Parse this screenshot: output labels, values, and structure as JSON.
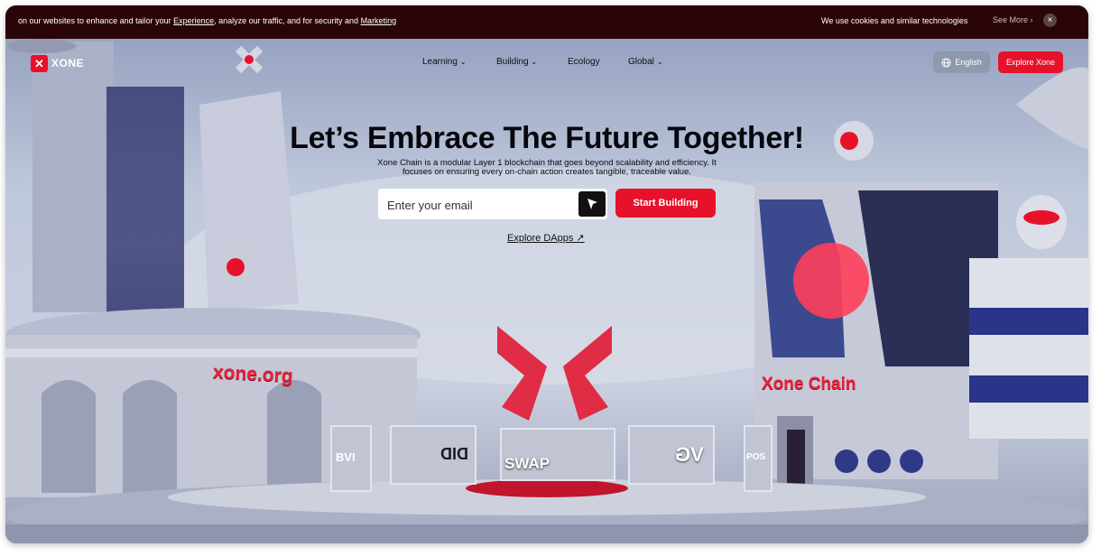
{
  "cookie_bar": {
    "message_start": "on our websites to enhance and tailor your ",
    "experience_link": "Experience",
    "message_middle": ", analyze our traffic, and for security and ",
    "marketing_link": "Marketing",
    "notice": "We use cookies and similar technologies",
    "see_more": "See More",
    "close": "×"
  },
  "nav": {
    "logo_text": "XONE",
    "items": [
      {
        "label": "Learning",
        "has_dropdown": true
      },
      {
        "label": "Building",
        "has_dropdown": true
      },
      {
        "label": "Ecology",
        "has_dropdown": false
      },
      {
        "label": "Global",
        "has_dropdown": true
      }
    ],
    "language_label": "English",
    "explore_label": "Explore Xone"
  },
  "hero": {
    "title": "Let’s Embrace The Future Together!",
    "subtitle_line1": "Xone Chain is a modular Layer 1 blockchain that goes beyond scalability and efficiency. It",
    "subtitle_line2": "focuses on ensuring every on-chain action creates tangible, traceable value.",
    "email_placeholder": "Enter your email",
    "start_button": "Start Building",
    "explore_dapps": "Explore DApps ↗"
  },
  "scene": {
    "sign_left": "xone.org",
    "sign_right": "Xone Chain",
    "screens": [
      "BVI",
      "DID",
      "SWAP",
      "VG",
      "POS"
    ]
  },
  "colors": {
    "accent": "#e8112a",
    "cookie_bg": "#2a0508",
    "title": "#07070d"
  }
}
